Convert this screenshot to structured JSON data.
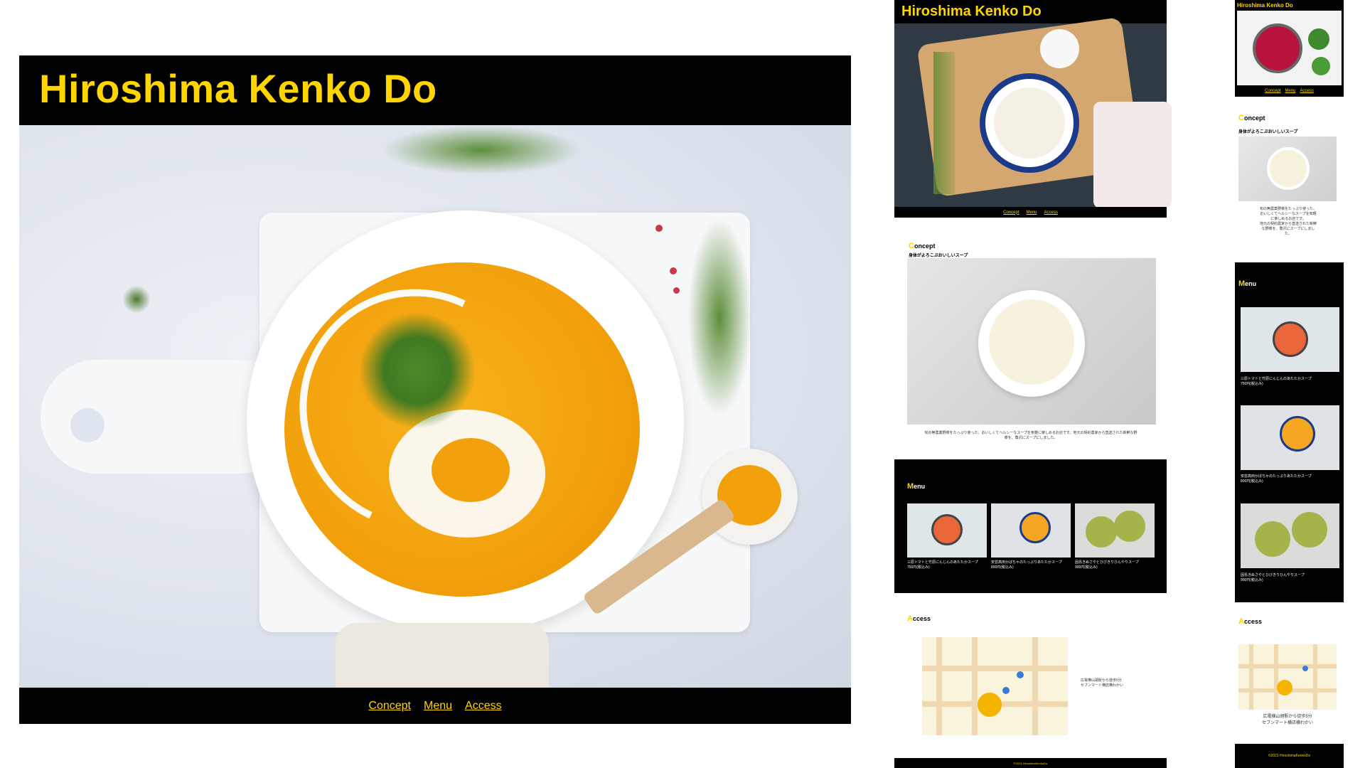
{
  "site": {
    "title": "Hiroshima Kenko Do"
  },
  "nav": {
    "concept": "Concept",
    "menu": "Menu",
    "access": "Access"
  },
  "concept": {
    "heading": "Concept",
    "subheading": "身体がよろこぶおいしいスープ",
    "body_wide": "旬の無農薬野菜をたっぷり使った、おいしくてヘルシーなスープを気軽に楽しめるお店です。地元の契約農家から直送された新鮮な野菜を、贅沢にスープにしました。",
    "body_lines": [
      "旬の無農薬野菜をたっぷり使った、",
      "おいしくてヘルシーなスープを気軽",
      "に楽しめるお店です。",
      "地元の契約農家から直送された新鮮",
      "な野菜を、贅沢にスープにしまし",
      "た。"
    ]
  },
  "menu": {
    "heading": "Menu",
    "items": [
      {
        "name": "三原トマトと竹原にんじんのあたたかスープ",
        "price": "750円(税込み)"
      },
      {
        "name": "安芸高田かぼちゃのたっぷりあたたかスープ",
        "price": "800円(税込み)"
      },
      {
        "name": "因島きぬさやとひびきりひんやりスープ",
        "price": "900円(税込み)"
      }
    ]
  },
  "access": {
    "heading": "Access",
    "directions": [
      "広電横山胡駅から徒歩5分",
      "セブンマート横店横わかい"
    ],
    "map_label": "Hiroshima Kenko Do",
    "store_label": "セブンマート"
  },
  "footer": {
    "copyright": "©2021 HiroshimaKenkoDo"
  },
  "colors": {
    "accent": "#ffd500",
    "dark": "#000000"
  }
}
